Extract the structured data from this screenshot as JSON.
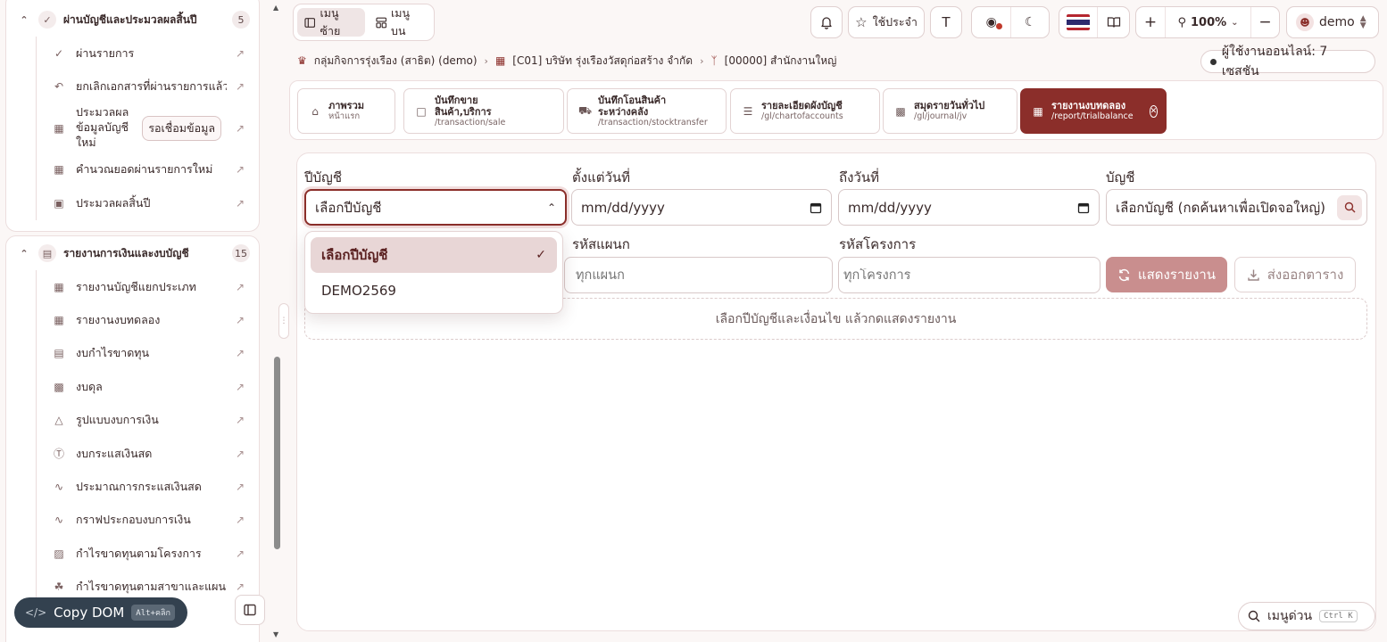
{
  "sidebar": {
    "group1": {
      "title": "ผ่านบัญชีและประมวลผลสิ้นปี",
      "count": "5",
      "items": [
        {
          "label": "ผ่านรายการ"
        },
        {
          "label": "ยกเลิกเอกสารที่ผ่านรายการแล้ว"
        },
        {
          "label": "ประมวลผลข้อมูลบัญชีใหม่",
          "pending": "รอเชื่อมข้อมูล"
        },
        {
          "label": "คำนวณยอดผ่านรายการใหม่"
        },
        {
          "label": "ประมวลผลสิ้นปี"
        }
      ]
    },
    "group2": {
      "title": "รายงานการเงินและงบบัญชี",
      "count": "15",
      "items": [
        {
          "label": "รายงานบัญชีแยกประเภท"
        },
        {
          "label": "รายงานงบทดลอง"
        },
        {
          "label": "งบกำไรขาดทุน"
        },
        {
          "label": "งบดุล"
        },
        {
          "label": "รูปแบบงบการเงิน"
        },
        {
          "label": "งบกระแสเงินสด"
        },
        {
          "label": "ประมาณการกระแสเงินสด"
        },
        {
          "label": "กราฟประกอบงบการเงิน"
        },
        {
          "label": "กำไรขาดทุนตามโครงการ"
        },
        {
          "label": "กำไรขาดทุนตามสาขาและแผนก"
        }
      ]
    },
    "copy_dom": {
      "label": "Copy DOM",
      "shortcut": "Alt+คลิก"
    }
  },
  "topbar": {
    "menu_left": "เมนูซ้าย",
    "menu_top": "เมนูบน",
    "favorites": "ใช้ประจำ",
    "font_btn": "T",
    "zoom": "100%",
    "user": "demo"
  },
  "breadcrumb": {
    "group": "กลุ่มกิจการรุ่งเรือง (สาธิต) (demo)",
    "company": "[C01] บริษัท รุ่งเรืองวัสดุก่อสร้าง จำกัด",
    "branch": "[00000] สำนักงานใหญ่"
  },
  "online": "ผู้ใช้งานออนไลน์: 7 เซสชัน",
  "tabs": [
    {
      "title": "ภาพรวม",
      "sub": "หน้าแรก"
    },
    {
      "title": "บันทึกขาย\nสินค้า,บริการ",
      "sub": "/transaction/sale"
    },
    {
      "title": "บันทึกโอนสินค้า\nระหว่างคลัง",
      "sub": "/transaction/stocktransfer"
    },
    {
      "title": "รายละเอียดผังบัญชี",
      "sub": "/gl/chartofaccounts"
    },
    {
      "title": "สมุดรายวันทั่วไป",
      "sub": "/gl/journal/jv"
    },
    {
      "title": "รายงานงบทดลอง",
      "sub": "/report/trialbalance"
    }
  ],
  "form": {
    "fiscal_year_label": "ปีบัญชี",
    "fiscal_year_value": "เลือกปีบัญชี",
    "from_date_label": "ตั้งแต่วันที่",
    "from_date_value": "mm/dd/yyyy",
    "to_date_label": "ถึงวันที่",
    "to_date_value": "mm/dd/yyyy",
    "account_label": "บัญชี",
    "account_value": "เลือกบัญชี (กดค้นหาเพื่อเปิดจอใหญ่)",
    "dept_label": "รหัสแผนก",
    "dept_placeholder": "ทุกแผนก",
    "project_label": "รหัสโครงการ",
    "project_placeholder": "ทุกโครงการ",
    "show_button": "แสดงรายงาน",
    "export_button": "ส่งออกตาราง",
    "hint": "เลือกปีบัญชีและเงื่อนไข แล้วกดแสดงรายงาน"
  },
  "dropdown": {
    "options": [
      {
        "label": "เลือกปีบัญชี",
        "selected": true
      },
      {
        "label": "DEMO2569",
        "selected": false
      }
    ]
  },
  "quick_menu": {
    "label": "เมนูด่วน",
    "shortcut": "Ctrl K"
  },
  "colors": {
    "accent": "#8b2e2a",
    "accent_soft": "#c98e8e",
    "background": "#fbf7f6"
  }
}
